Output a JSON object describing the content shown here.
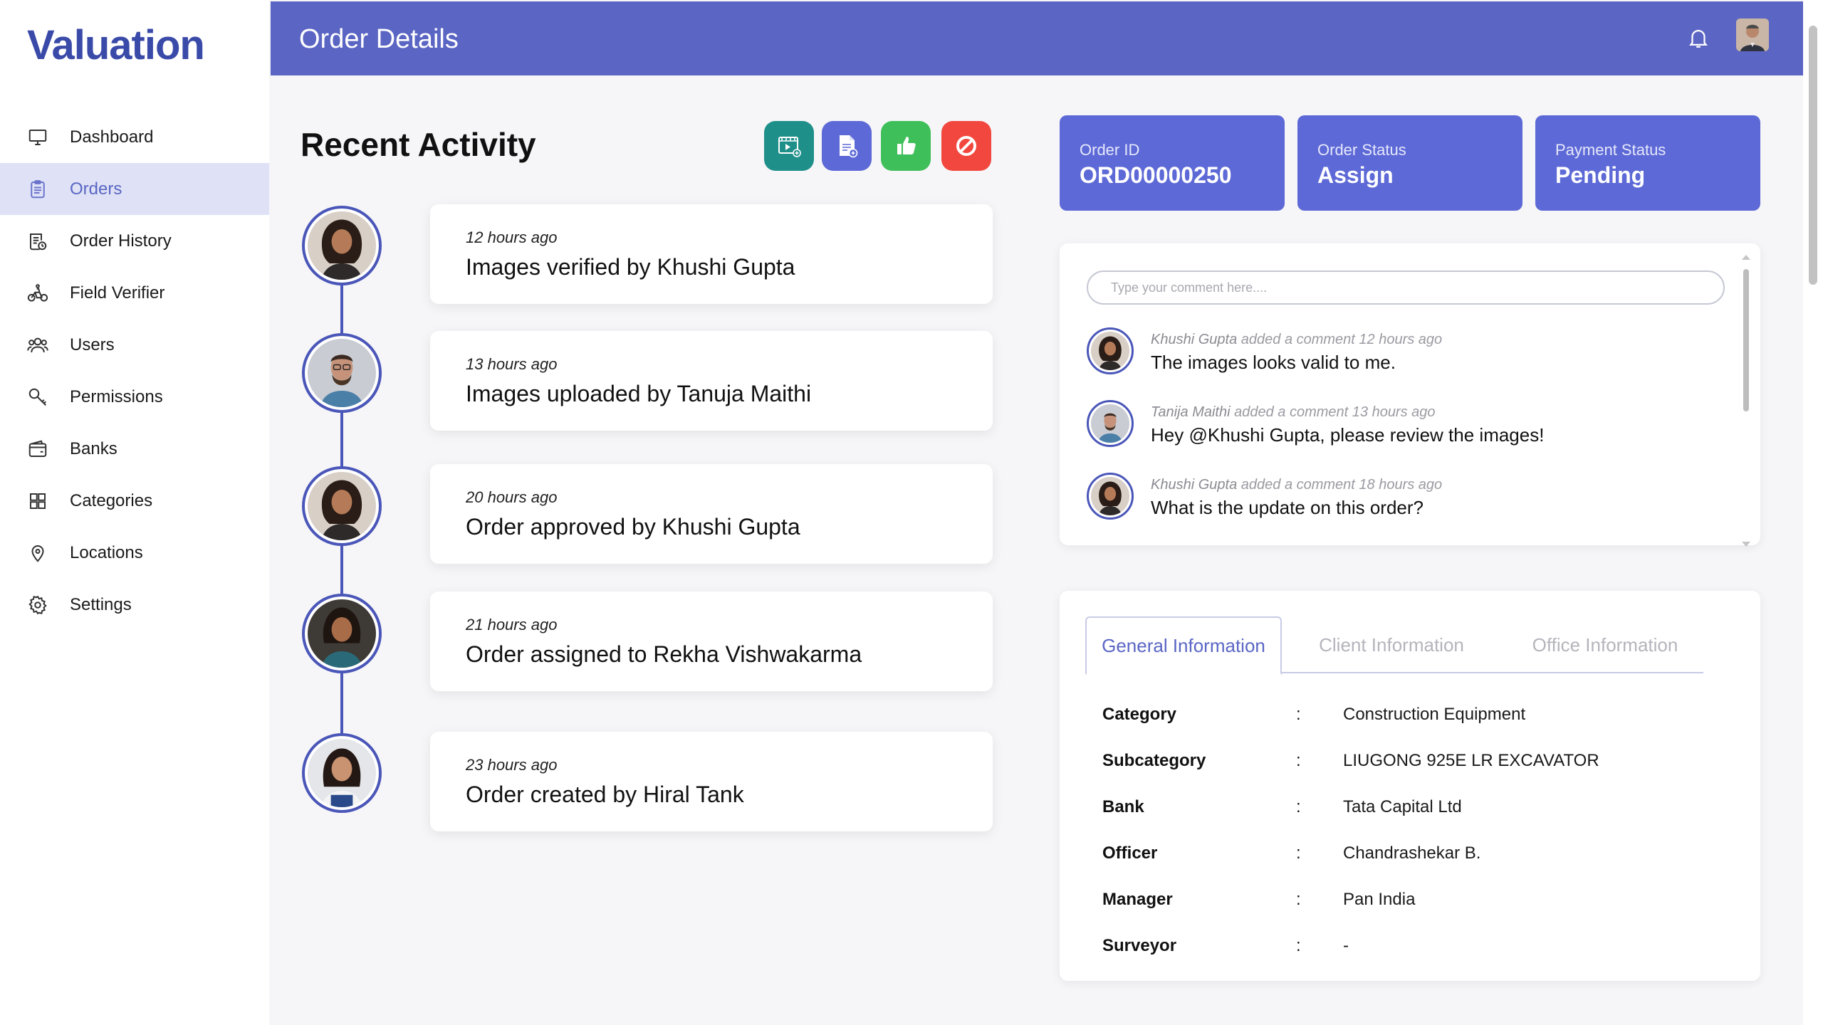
{
  "app": {
    "logo": "Valuation"
  },
  "sidebar": {
    "items": [
      {
        "label": "Dashboard",
        "icon": "monitor-icon",
        "active": false
      },
      {
        "label": "Orders",
        "icon": "clipboard-icon",
        "active": true
      },
      {
        "label": "Order History",
        "icon": "history-doc-icon",
        "active": false
      },
      {
        "label": "Field Verifier",
        "icon": "motorbike-icon",
        "active": false
      },
      {
        "label": "Users",
        "icon": "users-icon",
        "active": false
      },
      {
        "label": "Permissions",
        "icon": "key-icon",
        "active": false
      },
      {
        "label": "Banks",
        "icon": "wallet-icon",
        "active": false
      },
      {
        "label": "Categories",
        "icon": "grid-icon",
        "active": false
      },
      {
        "label": "Locations",
        "icon": "location-pin-icon",
        "active": false
      },
      {
        "label": "Settings",
        "icon": "gear-icon",
        "active": false
      }
    ]
  },
  "header": {
    "title": "Order Details"
  },
  "activity": {
    "title": "Recent Activity",
    "actions": [
      {
        "name": "video-gallery-button",
        "icon": "video-gallery-icon",
        "color": "#1f8f8a"
      },
      {
        "name": "add-document-button",
        "icon": "document-add-icon",
        "color": "#5d69d6"
      },
      {
        "name": "approve-button",
        "icon": "thumbs-up-icon",
        "color": "#3fbf5a"
      },
      {
        "name": "reject-button",
        "icon": "block-icon",
        "color": "#f2473e"
      }
    ],
    "items": [
      {
        "time": "12 hours ago",
        "text": "Images verified by Khushi Gupta"
      },
      {
        "time": "13 hours ago",
        "text": "Images uploaded by Tanuja Maithi"
      },
      {
        "time": "20 hours ago",
        "text": "Order approved by Khushi Gupta"
      },
      {
        "time": "21 hours ago",
        "text": "Order assigned to Rekha Vishwakarma"
      },
      {
        "time": "23 hours ago",
        "text": "Order created by Hiral Tank"
      }
    ]
  },
  "status": {
    "order_id_label": "Order ID",
    "order_id": "ORD00000250",
    "order_status_label": "Order Status",
    "order_status": "Assign",
    "payment_status_label": "Payment Status",
    "payment_status": "Pending",
    "card_color": "#5d69d6"
  },
  "comments": {
    "placeholder": "Type your comment here....",
    "items": [
      {
        "author": "Khushi Gupta",
        "action": "added a comment 12 hours ago",
        "text": "The images looks valid to me."
      },
      {
        "author": "Tanija Maithi",
        "action": "added a comment 13 hours ago",
        "text": "Hey @Khushi Gupta, please review the images!"
      },
      {
        "author": "Khushi Gupta",
        "action": "added a comment 18 hours ago",
        "text": "What is the update on this order?"
      }
    ]
  },
  "info": {
    "tabs": [
      "General Information",
      "Client Information",
      "Office Information"
    ],
    "active_tab": "General Information",
    "separator": ":",
    "rows": [
      {
        "key": "Category",
        "value": "Construction Equipment"
      },
      {
        "key": "Subcategory",
        "value": "LIUGONG 925E LR EXCAVATOR"
      },
      {
        "key": "Bank",
        "value": "Tata Capital Ltd"
      },
      {
        "key": "Officer",
        "value": "Chandrashekar B."
      },
      {
        "key": "Manager",
        "value": "Pan India"
      },
      {
        "key": "Surveyor",
        "value": "-"
      }
    ]
  },
  "colors": {
    "accent": "#5b65c3",
    "active_bg": "#dfe2f6",
    "timeline": "#4a56b8"
  }
}
